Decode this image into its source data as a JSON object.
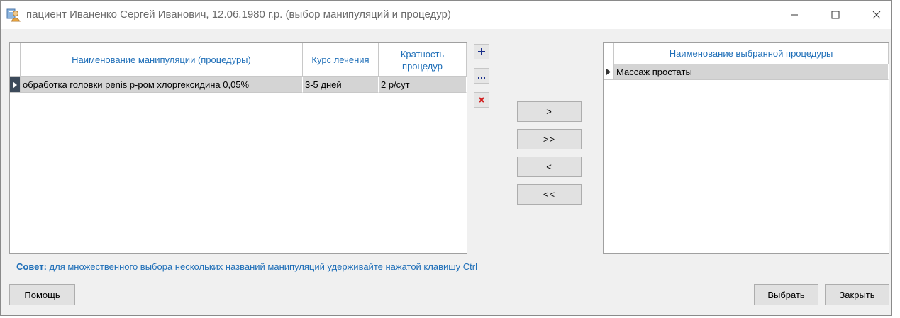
{
  "window": {
    "title": "пациент Иваненко Сергей Иванович, 12.06.1980 г.р. (выбор манипуляций и процедур)",
    "icon": "doctor-user-icon"
  },
  "left_table": {
    "columns": [
      "Наименование манипуляции (процедуры)",
      "Курс лечения",
      "Кратность процедур"
    ],
    "rows": [
      {
        "name": "обработка головки penis р-ром хлоргексидина 0,05%",
        "course": "3-5 дней",
        "frequency": "2 р/сут"
      }
    ]
  },
  "toolbar": {
    "add_icon": "plus-icon",
    "edit_icon": "ellipsis-icon",
    "delete_icon": "red-x-icon"
  },
  "move_buttons": {
    "add_one": ">",
    "add_all": ">>",
    "remove_one": "<",
    "remove_all": "<<"
  },
  "right_table": {
    "columns": [
      "Наименование выбранной процедуры"
    ],
    "rows": [
      {
        "name": "Массаж простаты"
      }
    ]
  },
  "hint": {
    "label": "Совет:",
    "text": " для множественного выбора нескольких названий манипуляций удерживайте нажатой клавишу Ctrl"
  },
  "buttons": {
    "help": "Помощь",
    "select": "Выбрать",
    "close": "Закрыть"
  },
  "colors": {
    "header_text": "#1f6fb8",
    "selected_row": "#d4d4d4",
    "delete_red": "#d22020",
    "add_blue": "#1a2f8a"
  }
}
